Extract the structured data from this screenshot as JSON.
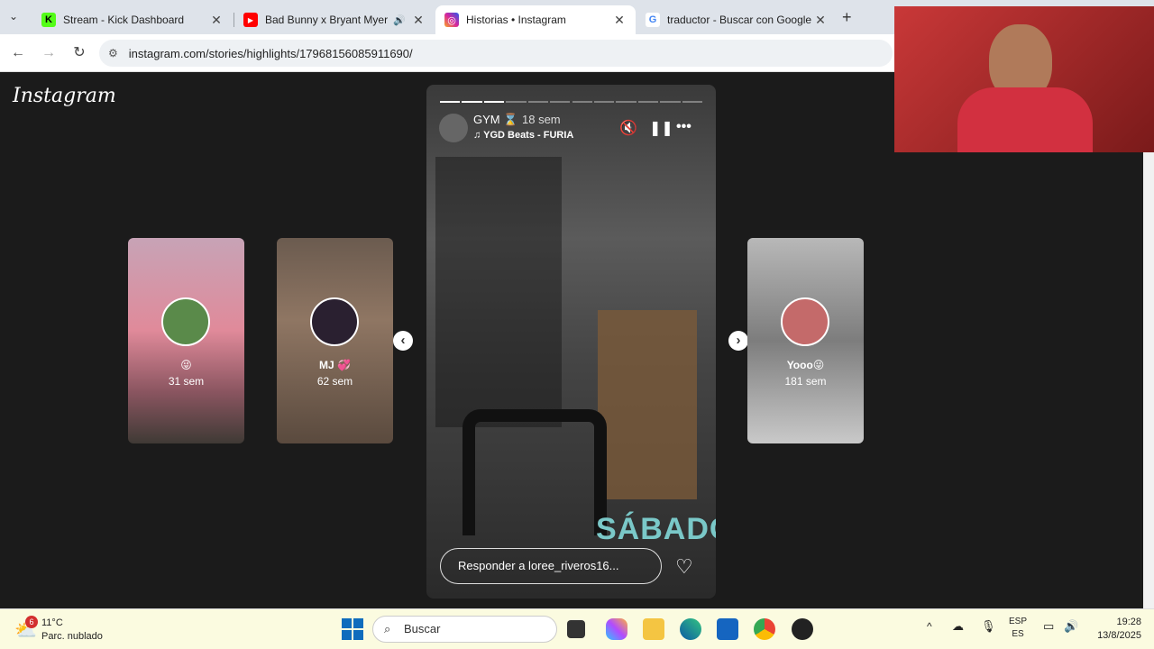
{
  "tabs": [
    {
      "title": "Stream - Kick Dashboard",
      "favicon": "K",
      "color": "#53fc18"
    },
    {
      "title": "Bad Bunny x Bryant Myers x",
      "favicon": "▶",
      "color": "#ff0000"
    },
    {
      "title": "Historias • Instagram",
      "favicon": "◎",
      "color": "#d6249f"
    },
    {
      "title": "traductor - Buscar con Google",
      "favicon": "G",
      "color": "#4285f4"
    }
  ],
  "url": "instagram.com/stories/highlights/17968156085911690/",
  "logo": "Instagram",
  "side_stories": [
    {
      "name": "😜",
      "age": "31 sem"
    },
    {
      "name": "MJ 💞",
      "age": "62 sem"
    },
    {
      "name": "Yooo😜",
      "age": "181 sem"
    }
  ],
  "story": {
    "user": "GYM ⌛",
    "age": "18 sem",
    "music": "YGD Beats - FURIA",
    "overlay_text": "SÁBADO",
    "reply_placeholder": "Responder a loree_riveros16...",
    "segments_total": 12,
    "segments_done": 3
  },
  "taskbar": {
    "weather_temp": "11°C",
    "weather_desc": "Parc. nublado",
    "weather_badge": "6",
    "search": "Buscar",
    "lang_top": "ESP",
    "lang_bottom": "ES",
    "time": "19:28",
    "date": "13/8/2025"
  }
}
